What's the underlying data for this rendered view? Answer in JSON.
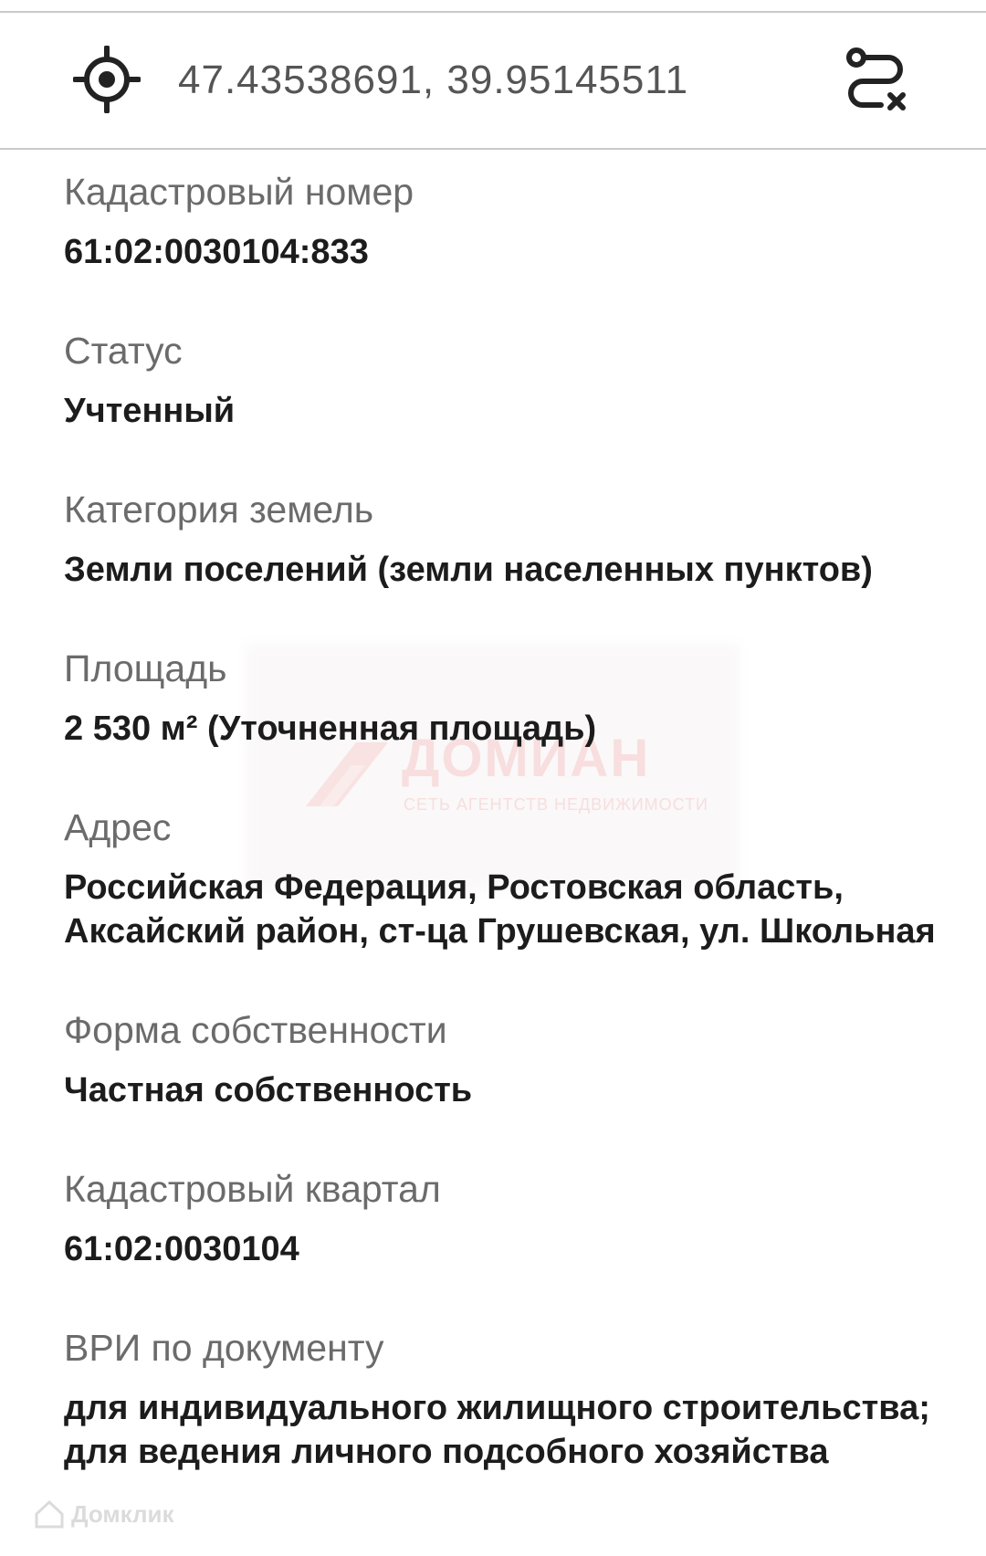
{
  "header": {
    "coordinates": "47.43538691, 39.95145511",
    "locate_icon": "crosshair-locate-icon",
    "route_icon": "route-clear-icon"
  },
  "fields": [
    {
      "label": "Кадастровый номер",
      "value": [
        "61:02:0030104:833"
      ]
    },
    {
      "label": "Статус",
      "value": [
        "Учтенный"
      ]
    },
    {
      "label": "Категория земель",
      "value": [
        "Земли поселений (земли населенных пунктов)"
      ]
    },
    {
      "label": "Площадь",
      "value": [
        "2 530 м² (Уточненная площадь)"
      ]
    },
    {
      "label": "Адрес",
      "value": [
        "Российская Федерация, Ростовская область,",
        "Аксайский район, ст-ца Грушевская, ул. Школьная"
      ]
    },
    {
      "label": "Форма собственности",
      "value": [
        "Частная собственность"
      ]
    },
    {
      "label": "Кадастровый квартал",
      "value": [
        "61:02:0030104"
      ]
    },
    {
      "label": "ВРИ по документу",
      "value": [
        "для индивидуального жилищного строительства;",
        "для ведения личного подсобного хозяйства"
      ]
    }
  ],
  "watermark": {
    "title": "ДОМИАН",
    "subtitle": "СЕТЬ АГЕНТСТВ НЕДВИЖИМОСТИ"
  },
  "corner_logo": {
    "text": "Домклик"
  },
  "colors": {
    "label": "#6b6b6b",
    "value": "#1c1c1c",
    "divider": "#c9c9c9",
    "watermark": "#f3c4c4"
  }
}
